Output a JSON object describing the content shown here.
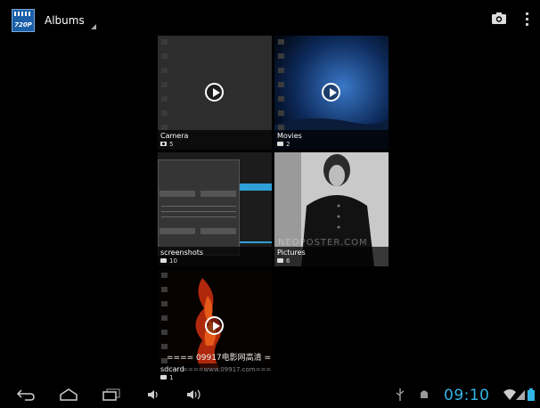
{
  "actionbar": {
    "app_icon_text": "720P",
    "title": "Albums"
  },
  "albums": [
    {
      "name": "Camera",
      "count": "5",
      "icon": "camera-icon",
      "is_video": true
    },
    {
      "name": "Movies",
      "count": "2",
      "icon": "folder-icon",
      "is_video": true
    },
    {
      "name": "screenshots",
      "count": "10",
      "icon": "folder-icon",
      "is_video": false
    },
    {
      "name": "Pictures",
      "count": "6",
      "icon": "folder-icon",
      "is_video": false
    },
    {
      "name": "sdcard",
      "count": "1",
      "icon": "folder-icon",
      "is_video": true
    }
  ],
  "overlay_text": {
    "sdcard_banner": "==== 09917电影网高清 ====",
    "sdcard_url": "====www.09917.com====",
    "pictures_watermark": "NEOPOSTER.COM"
  },
  "statusbar": {
    "time": "09:10"
  },
  "colors": {
    "background": "#000000",
    "accent": "#33b5e5"
  }
}
